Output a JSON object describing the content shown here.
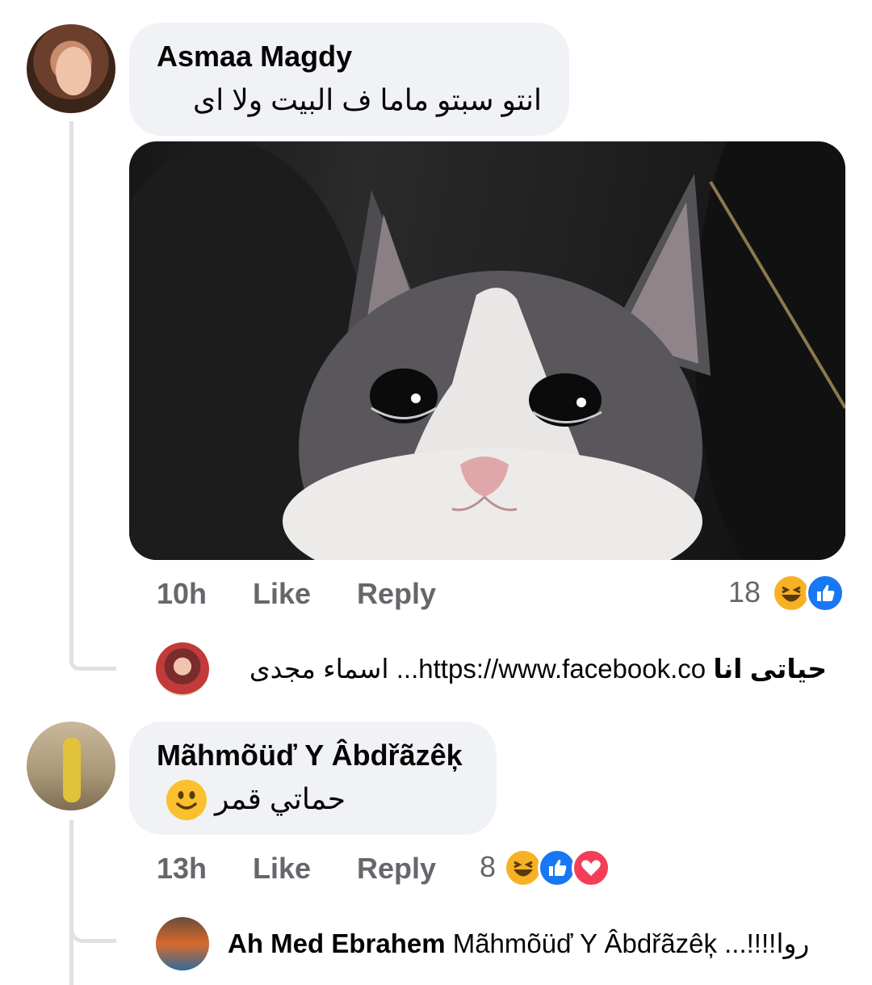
{
  "comments": [
    {
      "author": "Asmaa Magdy",
      "text": "انتو سبتو ماما ف البيت ولا اى",
      "time": "10h",
      "like_label": "Like",
      "reply_label": "Reply",
      "reaction_count": "18",
      "reactions": [
        "haha-icon",
        "like-icon"
      ],
      "reply_preview": {
        "name": "حياتى انا",
        "text": "https://www.facebook.co... اسماء مجدى"
      }
    },
    {
      "author": "Mãhmõüď Y Âbdřãzêķ",
      "text": "حماتي قمر",
      "emoji": "slightly-smiling-face-icon",
      "time": "13h",
      "like_label": "Like",
      "reply_label": "Reply",
      "reaction_count": "8",
      "reactions": [
        "haha-icon",
        "like-icon",
        "love-icon"
      ],
      "reply_preview": {
        "name": "Ah Med Ebrahem",
        "text": "Mãhmõüď Y Âbdřãzêķ ...!!!!روا"
      }
    }
  ],
  "colors": {
    "bubble": "#f0f2f5",
    "meta_text": "#65676b",
    "like_blue": "#1877f2",
    "love_red": "#f33e58",
    "haha_yellow": "#f7b125"
  }
}
